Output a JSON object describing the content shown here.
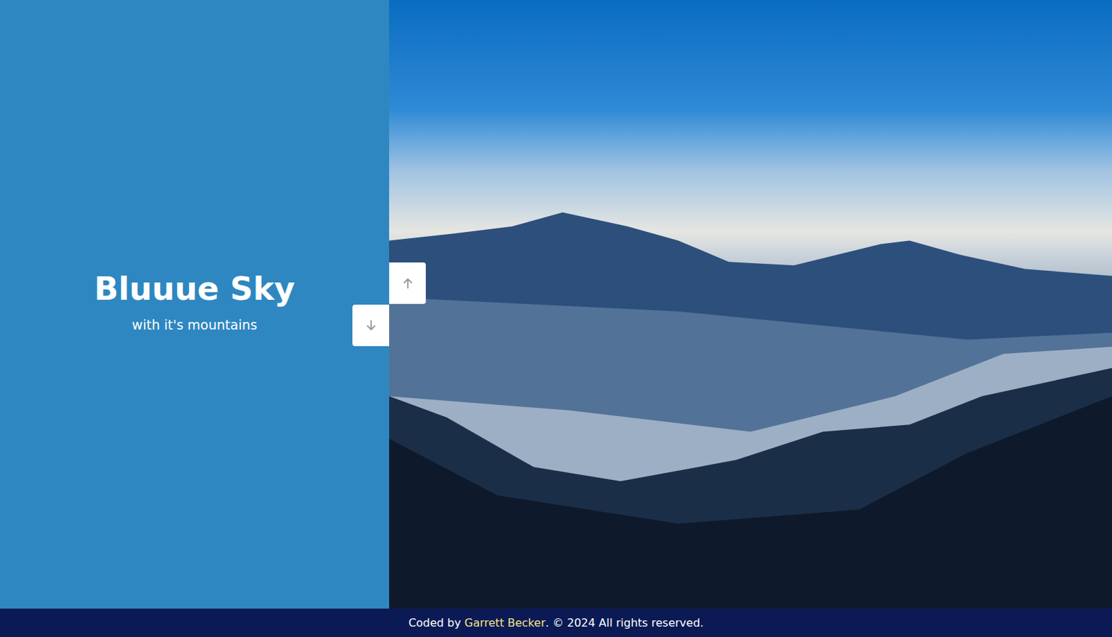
{
  "hero": {
    "title": "Bluuue Sky",
    "subtitle": "with it's mountains"
  },
  "photo": {
    "alt": "mountains"
  },
  "footer": {
    "prefix": "Coded by ",
    "author": "Garrett Becker",
    "suffix": ". © 2024 All rights reserved."
  }
}
